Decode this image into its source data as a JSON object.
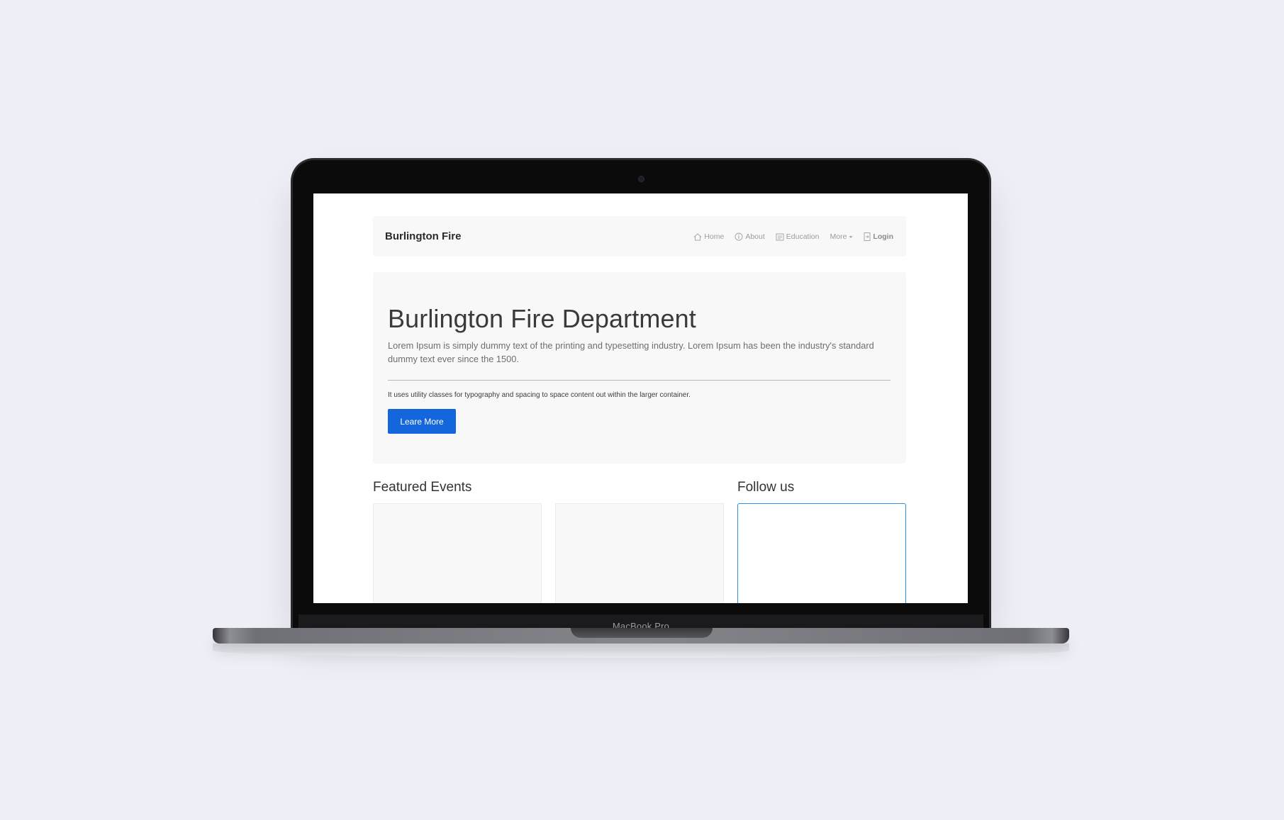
{
  "device": {
    "model_label": "MacBook Pro"
  },
  "navbar": {
    "brand": "Burlington Fire",
    "items": [
      {
        "label": "Home",
        "icon": "home-icon"
      },
      {
        "label": "About",
        "icon": "info-icon"
      },
      {
        "label": "Education",
        "icon": "book-icon"
      },
      {
        "label": "More",
        "icon": "caret-down-icon"
      },
      {
        "label": "Login",
        "icon": "login-icon"
      }
    ]
  },
  "hero": {
    "title": "Burlington Fire Department",
    "lead": "Lorem Ipsum is simply dummy text of the printing and typesetting industry. Lorem Ipsum has been the industry's standard dummy text ever since the 1500.",
    "note": "It uses utility classes for typography and spacing to space content out within the larger container.",
    "button_label": "Leare More"
  },
  "sections": {
    "featured_title": "Featured Events",
    "follow_title": "Follow us"
  },
  "colors": {
    "page_background": "#eff0f7",
    "primary_button": "#1466dc",
    "follow_border": "#2f8fe0"
  }
}
